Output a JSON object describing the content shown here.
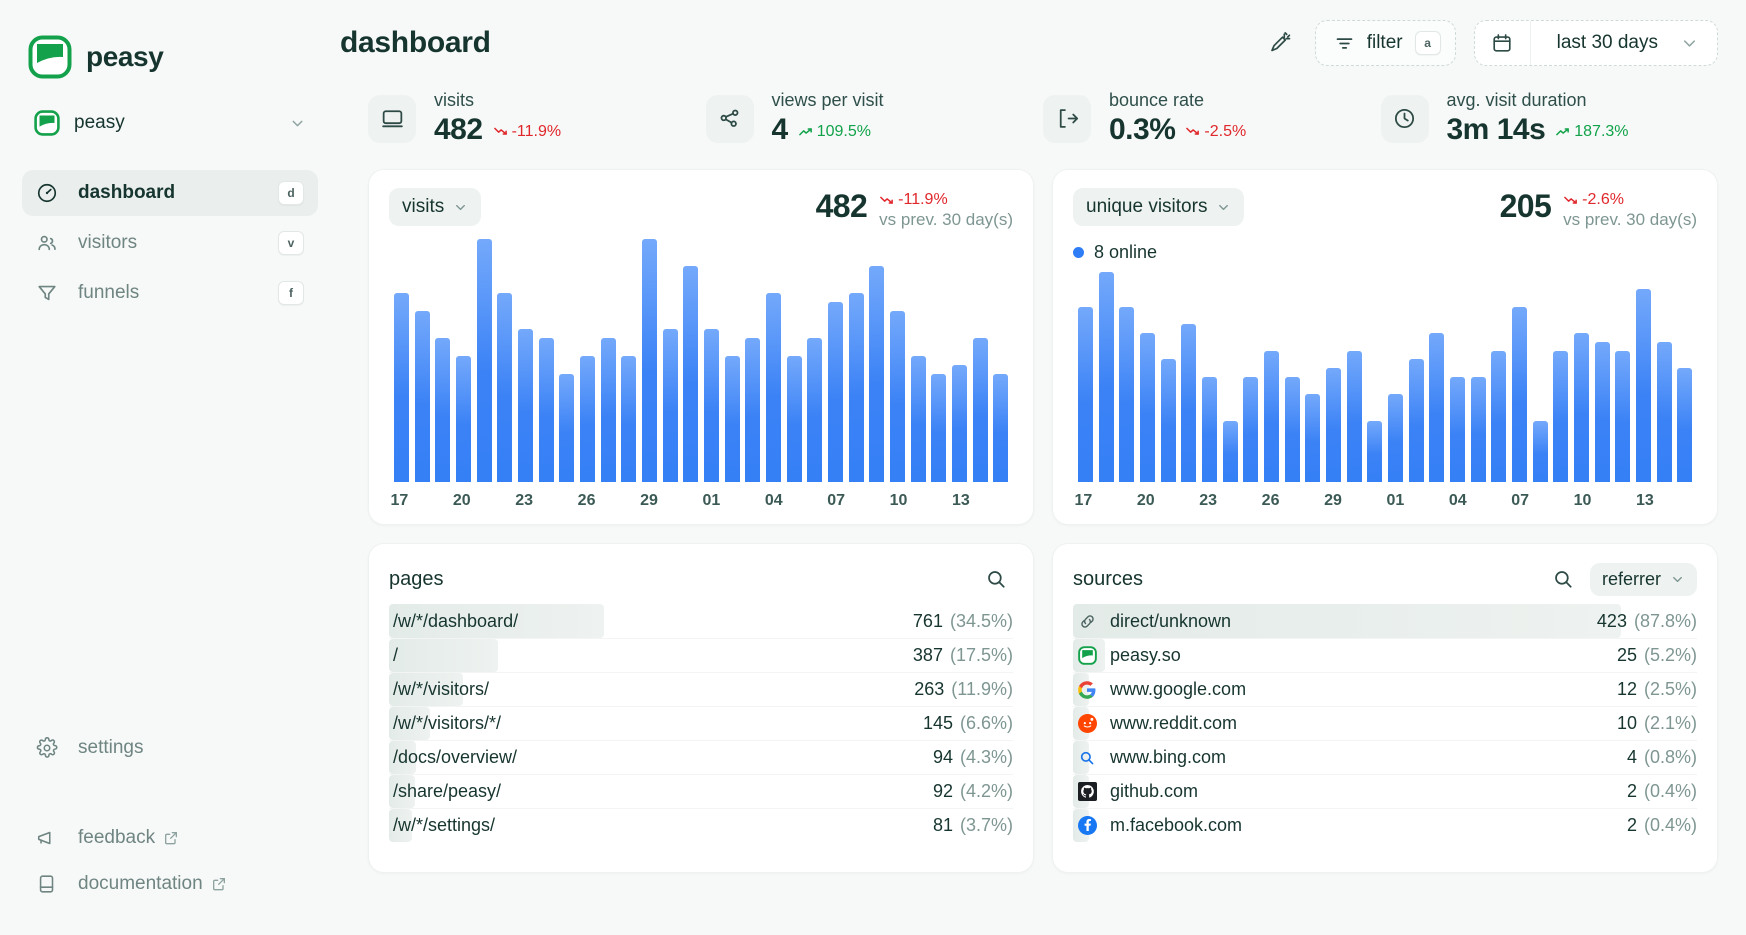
{
  "brand": {
    "name": "peasy",
    "logo_color": "#14a14b"
  },
  "sidebar": {
    "project": {
      "name": "peasy",
      "chevron": "chevron-down-icon"
    },
    "items": [
      {
        "label": "dashboard",
        "key": "d",
        "icon": "gauge-icon",
        "active": true
      },
      {
        "label": "visitors",
        "key": "v",
        "icon": "users-icon",
        "active": false
      },
      {
        "label": "funnels",
        "key": "f",
        "icon": "funnel-icon",
        "active": false
      }
    ],
    "bottom_items": [
      {
        "label": "settings",
        "icon": "gear-icon",
        "external": false
      },
      {
        "label": "feedback",
        "icon": "megaphone-icon",
        "external": true
      },
      {
        "label": "documentation",
        "icon": "book-icon",
        "external": true
      }
    ]
  },
  "header": {
    "title": "dashboard",
    "magic_icon": "magic-wand-icon",
    "filter": {
      "label": "filter",
      "key": "a",
      "icon": "filter-icon"
    },
    "date_range": {
      "label": "last 30 days",
      "icon": "calendar-icon",
      "chevron": "chevron-down-icon"
    }
  },
  "stats": [
    {
      "label": "visits",
      "value": "482",
      "delta": "-11.9%",
      "direction": "down",
      "icon": "monitor-icon"
    },
    {
      "label": "views per visit",
      "value": "4",
      "delta": "109.5%",
      "direction": "up",
      "icon": "share-nodes-icon"
    },
    {
      "label": "bounce rate",
      "value": "0.3%",
      "delta": "-2.5%",
      "direction": "down",
      "icon": "exit-icon"
    },
    {
      "label": "avg. visit duration",
      "value": "3m 14s",
      "delta": "187.3%",
      "direction": "up",
      "icon": "clock-icon"
    }
  ],
  "colors": {
    "accent_green": "#14a14b",
    "bar_blue": "#3b82f6",
    "positive": "#11a24a",
    "negative": "#e0272b",
    "muted": "#7e9692"
  },
  "charts": [
    {
      "metric_label": "visits",
      "total": "482",
      "delta": "-11.9%",
      "direction": "down",
      "compare_label": "vs prev. 30 day(s)",
      "online": null
    },
    {
      "metric_label": "unique visitors",
      "total": "205",
      "delta": "-2.6%",
      "direction": "down",
      "compare_label": "vs prev. 30 day(s)",
      "online": "8 online"
    }
  ],
  "chart_data": [
    {
      "type": "bar",
      "title": "visits",
      "xlabel": "",
      "ylabel": "visits",
      "grid": false,
      "legend": "none",
      "x": [
        "17",
        "18",
        "19",
        "20",
        "21",
        "22",
        "23",
        "24",
        "25",
        "26",
        "27",
        "28",
        "29",
        "30",
        "31",
        "01",
        "02",
        "03",
        "04",
        "05",
        "06",
        "07",
        "08",
        "09",
        "10",
        "11",
        "12",
        "13",
        "14",
        "15"
      ],
      "tick_labels": [
        "17",
        "",
        "",
        "20",
        "",
        "",
        "23",
        "",
        "",
        "26",
        "",
        "",
        "29",
        "",
        "",
        "01",
        "",
        "",
        "04",
        "",
        "",
        "07",
        "",
        "",
        "10",
        "",
        "",
        "13",
        "",
        ""
      ],
      "categories": [
        "17",
        "18",
        "19",
        "20",
        "21",
        "22",
        "23",
        "24",
        "25",
        "26",
        "27",
        "28",
        "29",
        "30",
        "31",
        "01",
        "02",
        "03",
        "04",
        "05",
        "06",
        "07",
        "08",
        "09",
        "10",
        "11",
        "12",
        "13",
        "14",
        "15"
      ],
      "values": [
        21,
        19,
        16,
        14,
        27,
        21,
        17,
        16,
        12,
        14,
        16,
        14,
        27,
        17,
        24,
        17,
        14,
        16,
        21,
        14,
        16,
        20,
        21,
        24,
        19,
        14,
        12,
        13,
        16,
        12
      ],
      "ylim": [
        0,
        28
      ]
    },
    {
      "type": "bar",
      "title": "unique visitors",
      "xlabel": "",
      "ylabel": "unique visitors",
      "grid": false,
      "legend": "none",
      "x": [
        "17",
        "18",
        "19",
        "20",
        "21",
        "22",
        "23",
        "24",
        "25",
        "26",
        "27",
        "28",
        "29",
        "30",
        "31",
        "01",
        "02",
        "03",
        "04",
        "05",
        "06",
        "07",
        "08",
        "09",
        "10",
        "11",
        "12",
        "13",
        "14",
        "15"
      ],
      "tick_labels": [
        "17",
        "",
        "",
        "20",
        "",
        "",
        "23",
        "",
        "",
        "26",
        "",
        "",
        "29",
        "",
        "",
        "01",
        "",
        "",
        "04",
        "",
        "",
        "07",
        "",
        "",
        "10",
        "",
        "",
        "13",
        "",
        ""
      ],
      "categories": [
        "17",
        "18",
        "19",
        "20",
        "21",
        "22",
        "23",
        "24",
        "25",
        "26",
        "27",
        "28",
        "29",
        "30",
        "31",
        "01",
        "02",
        "03",
        "04",
        "05",
        "06",
        "07",
        "08",
        "09",
        "10",
        "11",
        "12",
        "13",
        "14",
        "15"
      ],
      "values": [
        20,
        24,
        20,
        17,
        14,
        18,
        12,
        7,
        12,
        15,
        12,
        10,
        13,
        15,
        7,
        10,
        14,
        17,
        12,
        12,
        15,
        20,
        7,
        15,
        17,
        16,
        15,
        22,
        16,
        13
      ],
      "ylim": [
        0,
        25
      ]
    }
  ],
  "pages_panel": {
    "title": "pages",
    "search_icon": "search-icon",
    "rows": [
      {
        "label": "/w/*/dashboard/",
        "count": "761",
        "pct": "(34.5%)",
        "bar": 34.5
      },
      {
        "label": "/",
        "count": "387",
        "pct": "(17.5%)",
        "bar": 17.5
      },
      {
        "label": "/w/*/visitors/",
        "count": "263",
        "pct": "(11.9%)",
        "bar": 11.9
      },
      {
        "label": "/w/*/visitors/*/",
        "count": "145",
        "pct": "(6.6%)",
        "bar": 6.6
      },
      {
        "label": "/docs/overview/",
        "count": "94",
        "pct": "(4.3%)",
        "bar": 4.3
      },
      {
        "label": "/share/peasy/",
        "count": "92",
        "pct": "(4.2%)",
        "bar": 4.2
      },
      {
        "label": "/w/*/settings/",
        "count": "81",
        "pct": "(3.7%)",
        "bar": 3.7
      }
    ]
  },
  "sources_panel": {
    "title": "sources",
    "search_icon": "search-icon",
    "selector": {
      "label": "referrer",
      "chevron": "chevron-down-icon"
    },
    "rows": [
      {
        "label": "direct/unknown",
        "count": "423",
        "pct": "(87.8%)",
        "bar": 87.8,
        "icon": "link-icon"
      },
      {
        "label": "peasy.so",
        "count": "25",
        "pct": "(5.2%)",
        "bar": 5.2,
        "icon": "peasy-favicon"
      },
      {
        "label": "www.google.com",
        "count": "12",
        "pct": "(2.5%)",
        "bar": 2.5,
        "icon": "google-favicon"
      },
      {
        "label": "www.reddit.com",
        "count": "10",
        "pct": "(2.1%)",
        "bar": 2.1,
        "icon": "reddit-favicon"
      },
      {
        "label": "www.bing.com",
        "count": "4",
        "pct": "(0.8%)",
        "bar": 0.8,
        "icon": "bing-favicon"
      },
      {
        "label": "github.com",
        "count": "2",
        "pct": "(0.4%)",
        "bar": 0.4,
        "icon": "github-favicon"
      },
      {
        "label": "m.facebook.com",
        "count": "2",
        "pct": "(0.4%)",
        "bar": 0.4,
        "icon": "facebook-favicon"
      }
    ]
  }
}
